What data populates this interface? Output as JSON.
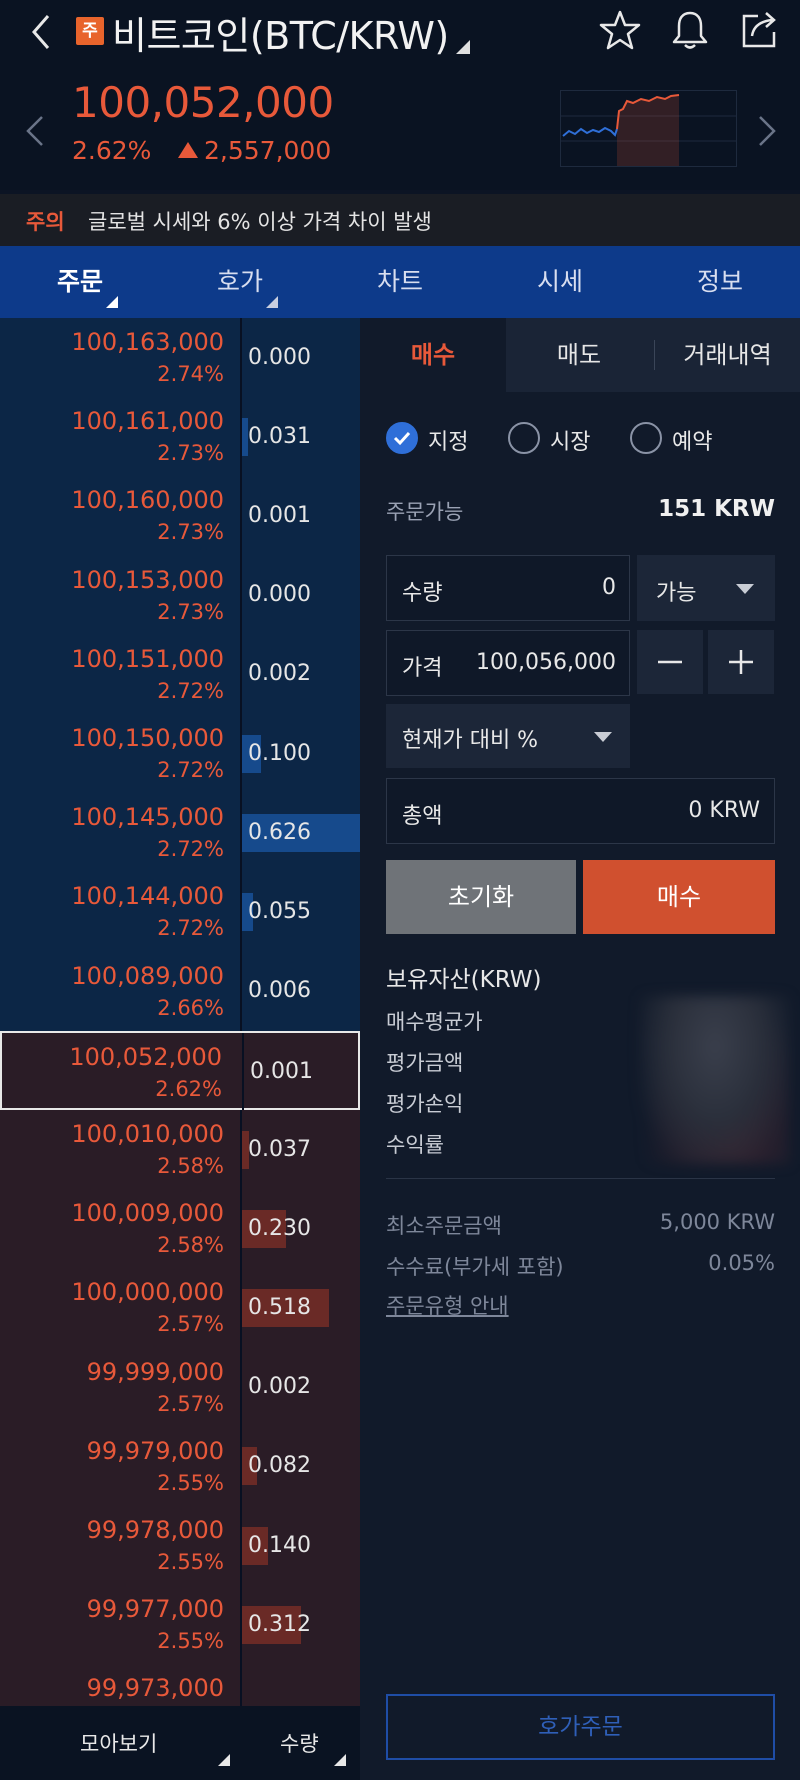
{
  "header": {
    "coin_badge": "주",
    "title": "비트코인(BTC/KRW)",
    "price": "100,052,000",
    "change_pct": "2.62%",
    "change_amount": "2,557,000"
  },
  "warning": {
    "label": "주의",
    "text": "글로벌 시세와 6% 이상 가격 차이 발생"
  },
  "tabs": [
    "주문",
    "호가",
    "차트",
    "시세",
    "정보"
  ],
  "order_book": {
    "rows": [
      {
        "price": "100,163,000",
        "pct": "2.74%",
        "qty": "0.000",
        "side": "ask",
        "bar": 0.0
      },
      {
        "price": "100,161,000",
        "pct": "2.73%",
        "qty": "0.031",
        "side": "ask",
        "bar": 0.05
      },
      {
        "price": "100,160,000",
        "pct": "2.73%",
        "qty": "0.001",
        "side": "ask",
        "bar": 0.0
      },
      {
        "price": "100,153,000",
        "pct": "2.73%",
        "qty": "0.000",
        "side": "ask",
        "bar": 0.0
      },
      {
        "price": "100,151,000",
        "pct": "2.72%",
        "qty": "0.002",
        "side": "ask",
        "bar": 0.0
      },
      {
        "price": "100,150,000",
        "pct": "2.72%",
        "qty": "0.100",
        "side": "ask",
        "bar": 0.16
      },
      {
        "price": "100,145,000",
        "pct": "2.72%",
        "qty": "0.626",
        "side": "ask",
        "bar": 1.0
      },
      {
        "price": "100,144,000",
        "pct": "2.72%",
        "qty": "0.055",
        "side": "ask",
        "bar": 0.09
      },
      {
        "price": "100,089,000",
        "pct": "2.66%",
        "qty": "0.006",
        "side": "ask",
        "bar": 0.0
      },
      {
        "price": "100,052,000",
        "pct": "2.62%",
        "qty": "0.001",
        "side": "bid",
        "bar": 0.0,
        "current": true
      },
      {
        "price": "100,010,000",
        "pct": "2.58%",
        "qty": "0.037",
        "side": "bid",
        "bar": 0.06
      },
      {
        "price": "100,009,000",
        "pct": "2.58%",
        "qty": "0.230",
        "side": "bid",
        "bar": 0.37
      },
      {
        "price": "100,000,000",
        "pct": "2.57%",
        "qty": "0.518",
        "side": "bid",
        "bar": 0.74
      },
      {
        "price": "99,999,000",
        "pct": "2.57%",
        "qty": "0.002",
        "side": "bid",
        "bar": 0.0
      },
      {
        "price": "99,979,000",
        "pct": "2.55%",
        "qty": "0.082",
        "side": "bid",
        "bar": 0.13
      },
      {
        "price": "99,978,000",
        "pct": "2.55%",
        "qty": "0.140",
        "side": "bid",
        "bar": 0.22
      },
      {
        "price": "99,977,000",
        "pct": "2.55%",
        "qty": "0.312",
        "side": "bid",
        "bar": 0.5
      },
      {
        "price": "99,973,000",
        "pct": "",
        "qty": "",
        "side": "bid",
        "bar": 0.0
      }
    ],
    "footer_left": "모아보기",
    "footer_right": "수량"
  },
  "order_panel": {
    "tabs": [
      "매수",
      "매도",
      "거래내역"
    ],
    "order_types": [
      "지정",
      "시장",
      "예약"
    ],
    "available_label": "주문가능",
    "available_value": "151 KRW",
    "qty_label": "수량",
    "qty_value": "0",
    "qty_dropdown": "가능",
    "price_label": "가격",
    "price_value": "100,056,000",
    "pct_dropdown": "현재가 대비 %",
    "total_label": "총액",
    "total_value": "0 KRW",
    "reset_label": "초기화",
    "buy_label": "매수",
    "assets_title": "보유자산(KRW)",
    "assets_rows": [
      "매수평균가",
      "평가금액",
      "평가손익",
      "수익률"
    ],
    "min_order_label": "최소주문금액",
    "min_order_value": "5,000 KRW",
    "fee_label": "수수료(부가세 포함)",
    "fee_value": "0.05%",
    "order_type_link": "주문유형 안내",
    "hoga_button": "호가주문"
  },
  "colors": {
    "up": "#e8593a",
    "tab_bar": "#0d3a8a",
    "ask_bg": "#0c2646",
    "bid_bg": "#2a1c26",
    "buy_button": "#d0502f"
  }
}
